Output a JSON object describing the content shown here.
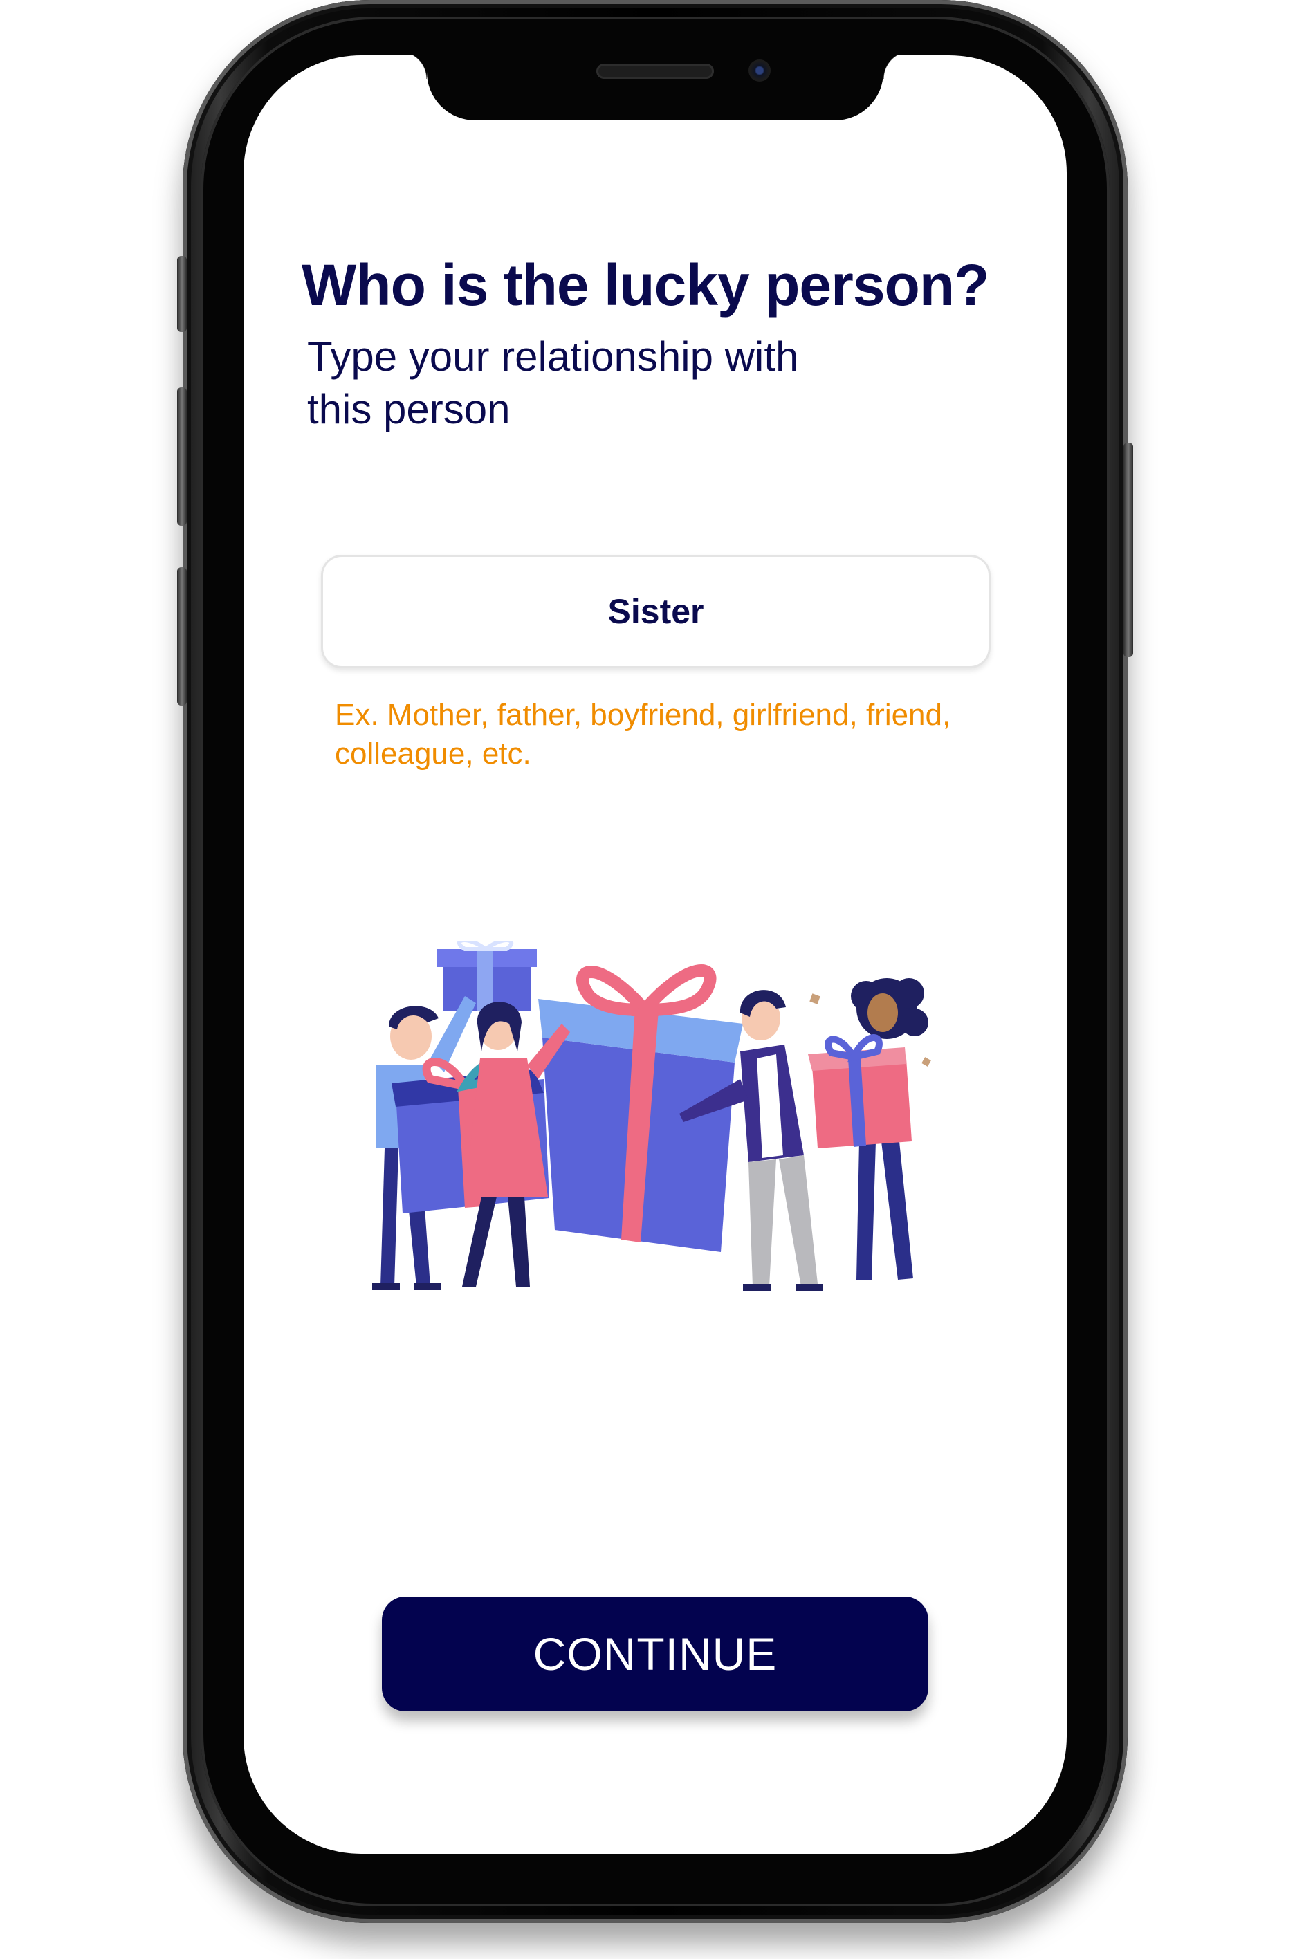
{
  "screen": {
    "title": "Who is the lucky person?",
    "subtitle": "Type your relationship with this person",
    "relationship_input": {
      "value": "Sister"
    },
    "hint": "Ex. Mother, father, boyfriend, girlfriend, friend, colleague, etc.",
    "illustration": "people-carrying-gifts-illustration",
    "continue_label": "CONTINUE"
  },
  "colors": {
    "navy": "#03034f",
    "hint_orange": "#f08c00",
    "gift_blue": "#5a63d8",
    "gift_light_blue": "#7fa8f0",
    "gift_pink": "#ee6b83"
  }
}
